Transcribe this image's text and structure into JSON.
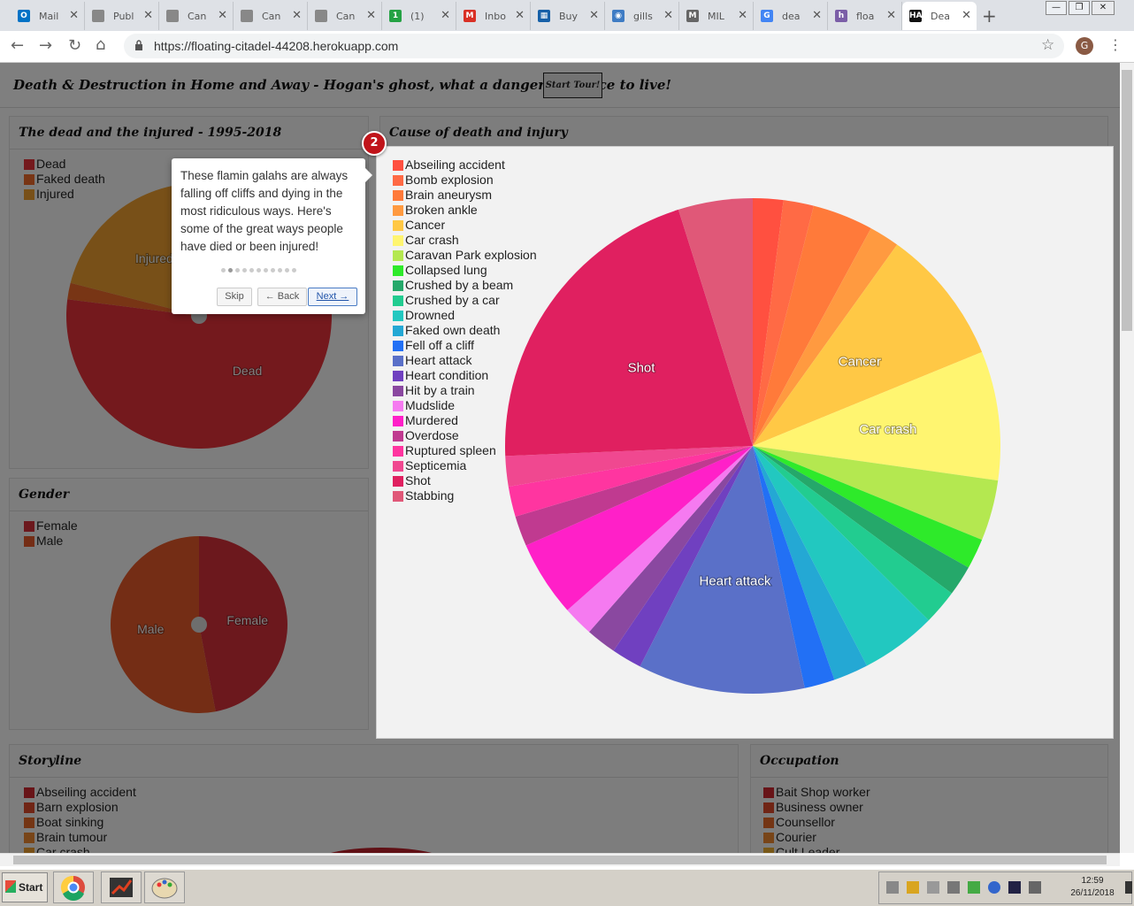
{
  "browser": {
    "tabs": [
      {
        "label": "Mail",
        "icon": "outlook-icon",
        "color": "#0072c6",
        "glyph": "O"
      },
      {
        "label": "Publ",
        "icon": "document-icon",
        "color": "#888888",
        "glyph": ""
      },
      {
        "label": "Can",
        "icon": "document-icon",
        "color": "#888888",
        "glyph": ""
      },
      {
        "label": "Can",
        "icon": "document-icon",
        "color": "#888888",
        "glyph": ""
      },
      {
        "label": "Can",
        "icon": "document-icon",
        "color": "#888888",
        "glyph": ""
      },
      {
        "label": "(1)",
        "icon": "whatsapp-icon",
        "color": "#25a244",
        "glyph": "1"
      },
      {
        "label": "Inbo",
        "icon": "gmail-icon",
        "color": "#d93025",
        "glyph": "M"
      },
      {
        "label": "Buy",
        "icon": "app-icon",
        "color": "#1660a8",
        "glyph": "▦"
      },
      {
        "label": "gills",
        "icon": "eye-icon",
        "color": "#3f7cc4",
        "glyph": "◉"
      },
      {
        "label": "MIL",
        "icon": "mp-icon",
        "color": "#666666",
        "glyph": "M"
      },
      {
        "label": "dea",
        "icon": "google-icon",
        "color": "#4285f4",
        "glyph": "G"
      },
      {
        "label": "floa",
        "icon": "heroku-icon",
        "color": "#7b5ea7",
        "glyph": "h"
      },
      {
        "label": "Dea",
        "icon": "ha-icon",
        "color": "#111111",
        "glyph": "HA"
      }
    ],
    "new_tab": "+",
    "url": "https://floating-citadel-44208.herokuapp.com",
    "avatar_letter": "G"
  },
  "header": {
    "title": "Death & Destruction in Home and Away - Hogan's ghost, what a dangerous place to live!",
    "tour_button": "Start Tour!"
  },
  "cards": {
    "dead_injured": {
      "title": "The dead and the injured - 1995-2018",
      "legend": [
        "Dead",
        "Faked death",
        "Injured"
      ]
    },
    "gender": {
      "title": "Gender",
      "legend": [
        "Female",
        "Male"
      ]
    },
    "cause": {
      "title": "Cause of death and injury"
    },
    "storyline": {
      "title": "Storyline",
      "legend": [
        "Abseiling accident",
        "Barn explosion",
        "Boat sinking",
        "Brain tumour",
        "Car crash"
      ]
    },
    "occupation": {
      "title": "Occupation",
      "legend": [
        "Bait Shop worker",
        "Business owner",
        "Counsellor",
        "Courier",
        "Cult Leader"
      ]
    }
  },
  "tour": {
    "step": "2",
    "text": "These flamin galahs are always falling off cliffs and dying in the most ridiculous ways. Here's some of the great ways people have died or been injured!",
    "total_steps": 11,
    "current_step": 2,
    "skip": "Skip",
    "back": "← Back",
    "next": "Next →"
  },
  "chart_data": [
    {
      "type": "pie",
      "title": "The dead and the injured - 1995-2018",
      "categories": [
        "Dead",
        "Faked death",
        "Injured"
      ],
      "values": [
        77,
        2,
        21
      ],
      "labels_shown": [
        "Dead",
        "Injured"
      ],
      "colors": [
        "#e8333a",
        "#f06a2a",
        "#f0a030"
      ]
    },
    {
      "type": "pie",
      "title": "Gender",
      "categories": [
        "Female",
        "Male"
      ],
      "values": [
        47,
        53
      ],
      "colors": [
        "#d9303a",
        "#e85a2a"
      ]
    },
    {
      "type": "pie",
      "title": "Cause of death and injury",
      "categories": [
        "Abseiling accident",
        "Bomb explosion",
        "Brain aneurysm",
        "Broken ankle",
        "Cancer",
        "Car crash",
        "Caravan Park explosion",
        "Collapsed lung",
        "Crushed by a beam",
        "Crushed by a car",
        "Drowned",
        "Faked own death",
        "Fell off a cliff",
        "Heart attack",
        "Heart condition",
        "Hit by a train",
        "Mudslide",
        "Murdered",
        "Overdose",
        "Ruptured spleen",
        "Septicemia",
        "Shot",
        "Stabbing"
      ],
      "values": [
        2,
        2,
        4,
        2,
        9,
        8.5,
        4,
        2,
        2,
        2.3,
        5,
        2.3,
        2,
        11,
        2,
        2,
        2,
        5,
        2,
        2,
        2,
        21,
        4.9
      ],
      "colors": [
        "#ff5040",
        "#ff6a45",
        "#ff7a3a",
        "#ff9a40",
        "#ffc845",
        "#fff570",
        "#b4e850",
        "#2eea2a",
        "#25a86a",
        "#22cc90",
        "#22c8c0",
        "#24a8d4",
        "#2270f5",
        "#5a70c8",
        "#7040c0",
        "#8a48a0",
        "#f57af0",
        "#ff20c8",
        "#c03a90",
        "#ff35a0",
        "#f04890",
        "#e02060",
        "#e05878"
      ],
      "labels_shown": [
        "Shot",
        "Cancer",
        "Car crash",
        "Heart attack"
      ]
    }
  ],
  "taskbar": {
    "start": "Start",
    "time": "12:59",
    "date": "26/11/2018"
  }
}
